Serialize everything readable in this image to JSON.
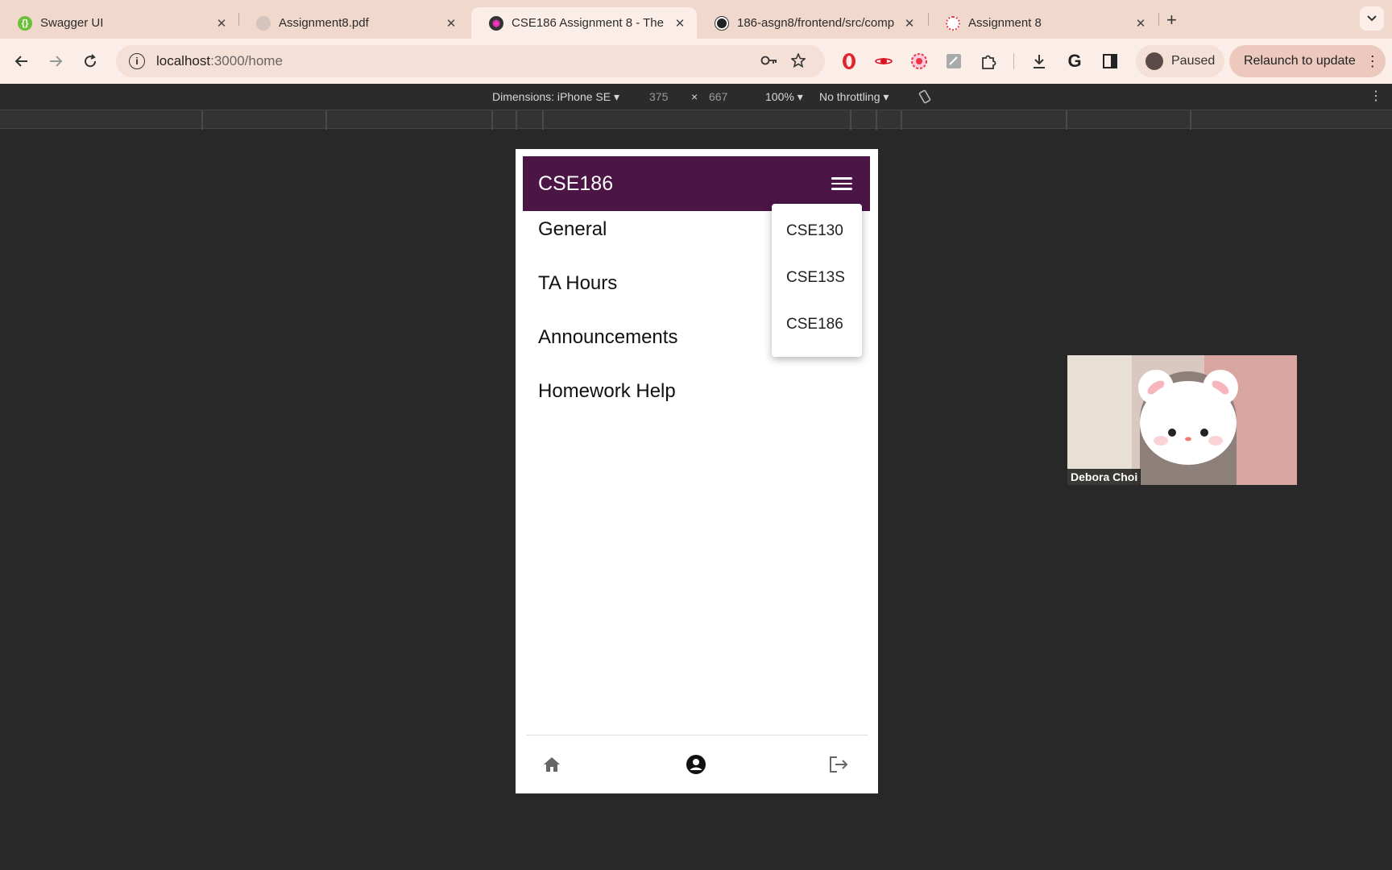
{
  "browser": {
    "tabs": [
      {
        "title": "Swagger UI",
        "favicon": "swagger-icon",
        "active": false
      },
      {
        "title": "Assignment8.pdf",
        "favicon": "pdf-icon",
        "active": false
      },
      {
        "title": "CSE186 Assignment 8 - The",
        "favicon": "app-icon",
        "active": true
      },
      {
        "title": "186-asgn8/frontend/src/comp",
        "favicon": "github-icon",
        "active": false
      },
      {
        "title": "Assignment 8",
        "favicon": "canvas-icon",
        "active": false
      }
    ],
    "close_glyph": "✕",
    "new_tab_glyph": "+",
    "url_host": "localhost",
    "url_path": ":3000/home",
    "profile_status": "Paused",
    "relaunch_label": "Relaunch to update"
  },
  "devtools": {
    "dimensions_label": "Dimensions: iPhone SE ▾",
    "width_value": "375",
    "times": "×",
    "height_value": "667",
    "zoom": "100% ▾",
    "throttling": "No throttling ▾"
  },
  "app": {
    "title": "CSE186",
    "channels": [
      "General",
      "TA Hours",
      "Announcements",
      "Homework Help"
    ],
    "workspaces": [
      "CSE130",
      "CSE13S",
      "CSE186"
    ]
  },
  "video": {
    "name": "Debora Choi"
  },
  "colors": {
    "app_bar": "#4b1546",
    "page_bg": "#282828",
    "tab_strip": "#f0d8cd"
  }
}
